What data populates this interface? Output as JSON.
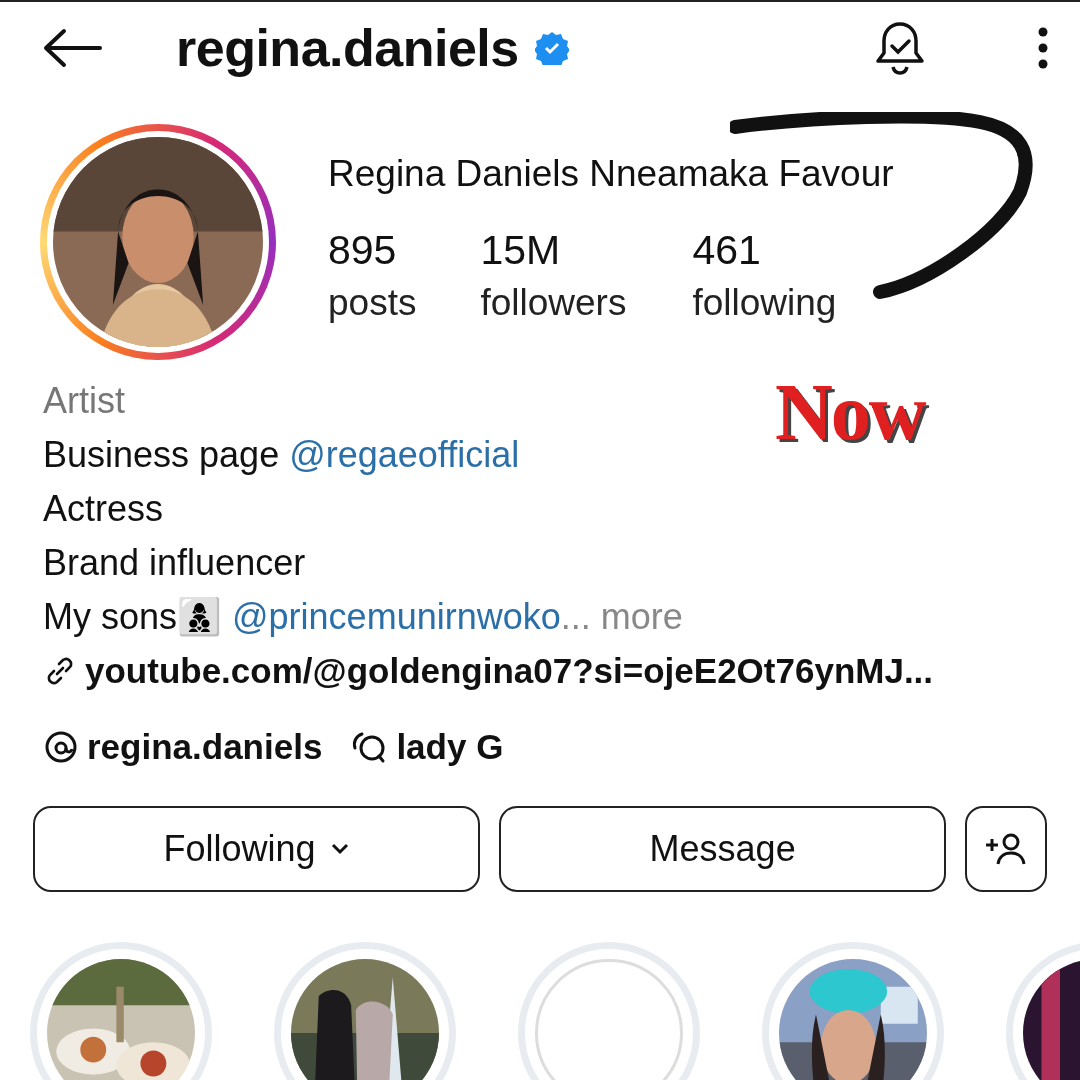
{
  "header": {
    "username": "regina.daniels",
    "verified": true
  },
  "profile": {
    "full_name": "Regina Daniels Nneamaka Favour",
    "stats": [
      {
        "value": "895",
        "label": "posts"
      },
      {
        "value": "15M",
        "label": "followers"
      },
      {
        "value": "461",
        "label": "following"
      }
    ]
  },
  "annotation": {
    "text": "Now"
  },
  "bio": {
    "category": "Artist",
    "lines": [
      [
        {
          "kind": "text",
          "text": "Business page "
        },
        {
          "kind": "mention",
          "text": "@regaeofficial"
        }
      ],
      [
        {
          "kind": "text",
          "text": "Actress"
        }
      ],
      [
        {
          "kind": "text",
          "text": "Brand influencer"
        }
      ],
      [
        {
          "kind": "text",
          "text": "My sons👩‍👦‍👦 "
        },
        {
          "kind": "mention",
          "text": "@princemunirnwoko"
        },
        {
          "kind": "more",
          "text": "... more"
        }
      ]
    ],
    "link": "youtube.com/@goldengina07?si=ojeE2Ot76ynMJ...",
    "badges": [
      {
        "kind": "threads",
        "text": "regina.daniels"
      },
      {
        "kind": "chat",
        "text": "lady G"
      }
    ]
  },
  "buttons": [
    {
      "kind": "dropdown",
      "label": "Following"
    },
    {
      "kind": "plain",
      "label": "Message"
    },
    {
      "kind": "icon"
    }
  ],
  "highlights": [
    {
      "kind": "picture"
    },
    {
      "kind": "picture"
    },
    {
      "kind": "empty"
    },
    {
      "kind": "picture"
    },
    {
      "kind": "picture"
    }
  ]
}
